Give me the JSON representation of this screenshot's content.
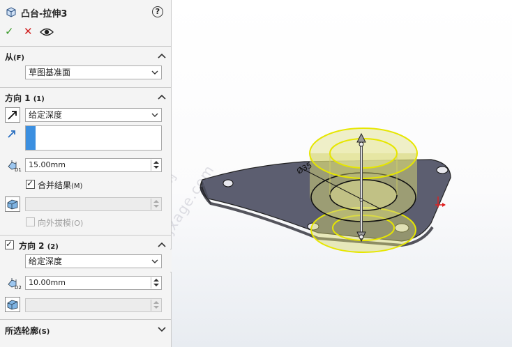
{
  "header": {
    "title": "凸台-拉伸3",
    "help_label": "?"
  },
  "actions": {
    "ok": "✓",
    "cancel": "✕"
  },
  "from": {
    "title": "从",
    "title_key": "(F)",
    "start_condition": "草图基准面"
  },
  "direction1": {
    "title": "方向 1",
    "title_key": "(1)",
    "end_condition": "给定深度",
    "depth_label": "D1",
    "depth": "15.00mm",
    "merge_label": "合并结果",
    "merge_key": "(M)",
    "merge_checked": true,
    "draft_outward_label": "向外拔模",
    "draft_outward_key": "(O)"
  },
  "direction2": {
    "title": "方向 2",
    "title_key": "(2)",
    "enabled": true,
    "end_condition": "给定深度",
    "depth_label": "D2",
    "depth": "10.00mm"
  },
  "selected_contours": {
    "title": "所选轮廓",
    "title_key": "(S)"
  },
  "viewport": {
    "watermark_cn": "机械时代网",
    "watermark_en": "www.jxage.com"
  },
  "colors": {
    "accent_blue": "#3b8fe0",
    "preview_yellow": "#e6e600",
    "ok_green": "#3a9a2a",
    "cancel_red": "#d02020"
  }
}
